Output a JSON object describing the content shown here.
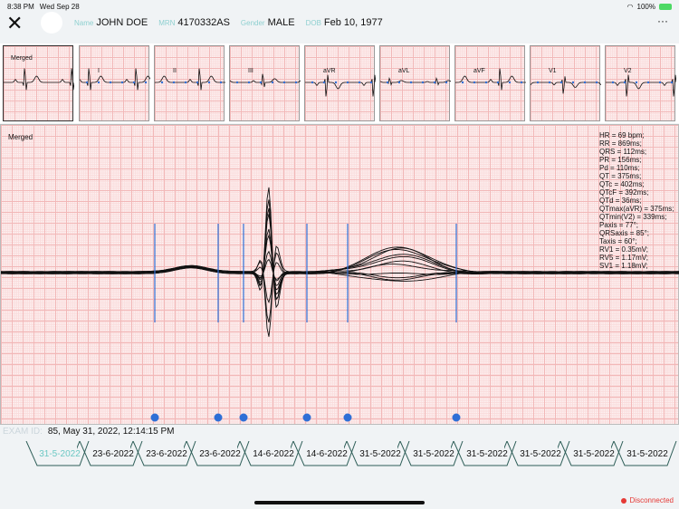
{
  "status": {
    "time": "8:38 PM",
    "date": "Wed Sep 28",
    "battery": "100%"
  },
  "patient": {
    "name_label": "Name",
    "name": "JOHN DOE",
    "mrn_label": "MRN",
    "mrn": "4170332AS",
    "gender_label": "Gender",
    "gender": "MALE",
    "dob_label": "DOB",
    "dob": "Feb 10, 1977"
  },
  "leads": [
    "Merged",
    "I",
    "II",
    "III",
    "aVR",
    "aVL",
    "aVF",
    "V1",
    "V2"
  ],
  "main": {
    "title": "Merged",
    "measurements": [
      "HR = 69 bpm;",
      "RR = 869ms;",
      "QRS = 112ms;",
      "PR = 156ms;",
      "Pd = 110ms;",
      "QT = 375ms;",
      "QTc = 402ms;",
      "QTcF = 392ms;",
      "QTd = 36ms;",
      "QTmax(aVR) = 375ms;",
      "QTmin(V2) = 339ms;",
      "Paxis = 77°;",
      "QRSaxis = 85°;",
      "Taxis = 60°;",
      "RV1 = 0.35mV;",
      "RV5 = 1.17mV;",
      "SV1 = 1.18mV;"
    ]
  },
  "exam": {
    "label": "EXAM ID:",
    "value": "85,  May 31, 2022, 12:14:15 PM"
  },
  "tabs": [
    "31-5-2022",
    "23-6-2022",
    "23-6-2022",
    "23-6-2022",
    "14-6-2022",
    "14-6-2022",
    "31-5-2022",
    "31-5-2022",
    "31-5-2022",
    "31-5-2022",
    "31-5-2022",
    "31-5-2022"
  ],
  "connection": "Disconnected",
  "colors": {
    "accent": "#6cc8c4",
    "marker": "#2f6fd6",
    "error": "#e53935"
  }
}
